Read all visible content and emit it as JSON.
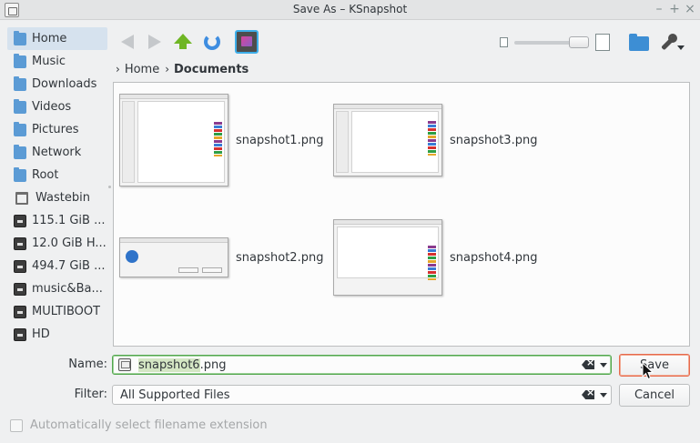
{
  "window": {
    "title": "Save As – KSnapshot"
  },
  "sidebar": {
    "items": [
      {
        "label": "Home",
        "icon": "home-icon",
        "active": true
      },
      {
        "label": "Music",
        "icon": "music-folder-icon"
      },
      {
        "label": "Downloads",
        "icon": "downloads-folder-icon"
      },
      {
        "label": "Videos",
        "icon": "videos-folder-icon"
      },
      {
        "label": "Pictures",
        "icon": "pictures-folder-icon"
      },
      {
        "label": "Network",
        "icon": "network-folder-icon"
      },
      {
        "label": "Root",
        "icon": "root-folder-icon"
      },
      {
        "label": "Wastebin",
        "icon": "trash-icon"
      },
      {
        "label": "115.1 GiB ...",
        "icon": "drive-icon"
      },
      {
        "label": "12.0 GiB H...",
        "icon": "drive-icon"
      },
      {
        "label": "494.7 GiB ...",
        "icon": "drive-icon"
      },
      {
        "label": "music&Ba...",
        "icon": "drive-icon"
      },
      {
        "label": "MULTIBOOT",
        "icon": "drive-icon"
      },
      {
        "label": "HD",
        "icon": "drive-icon"
      }
    ]
  },
  "breadcrumb": {
    "items": [
      "Home",
      "Documents"
    ],
    "separator": "›"
  },
  "files": [
    {
      "name": "snapshot1.png",
      "kind": "settings-window"
    },
    {
      "name": "snapshot3.png",
      "kind": "settings-window"
    },
    {
      "name": "snapshot2.png",
      "kind": "dialog"
    },
    {
      "name": "snapshot4.png",
      "kind": "color-list"
    }
  ],
  "form": {
    "name_label": "Name:",
    "name_selected": "snapshot6",
    "name_rest": ".png",
    "filter_label": "Filter:",
    "filter_value": "All Supported Files",
    "save_label": "Save",
    "cancel_label": "Cancel",
    "auto_ext_label": "Automatically select filename extension"
  },
  "colors": {
    "accent_focus": "#52a74d",
    "default_button": "#e66a4d",
    "selection": "#d6e2ee"
  }
}
